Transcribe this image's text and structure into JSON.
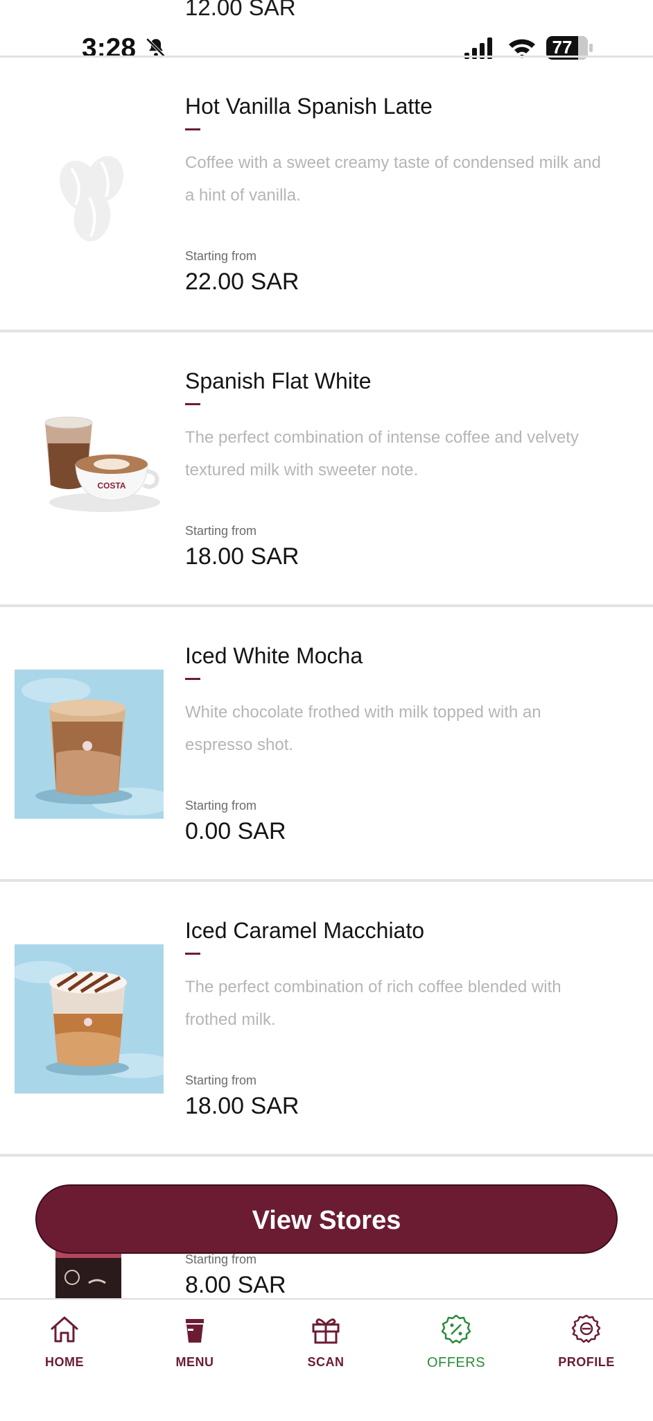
{
  "status_bar": {
    "time": "3:28",
    "battery": "77",
    "cut_off_price": "12.00 SAR"
  },
  "products": [
    {
      "name": "Hot Vanilla Spanish Latte",
      "description": "Coffee with a sweet creamy taste of condensed milk and a hint of vanilla.",
      "price_prefix": "Starting from",
      "price": "22.00 SAR",
      "image": "coffee-bean-placeholder-icon"
    },
    {
      "name": "Spanish Flat White",
      "description": "The perfect combination of intense coffee and velvety textured milk with sweeter note.",
      "price_prefix": "Starting from",
      "price": "18.00 SAR",
      "image": "flat-white-cup-photo",
      "cup_brand": "COSTA"
    },
    {
      "name": "Iced White Mocha",
      "description": "White chocolate frothed with milk topped with an espresso shot.",
      "price_prefix": "Starting from",
      "price": "0.00 SAR",
      "image": "iced-mocha-glass-photo"
    },
    {
      "name": "Iced Caramel Macchiato",
      "description": "The perfect combination of rich coffee blended with frothed milk.",
      "price_prefix": "Starting from",
      "price": "18.00 SAR",
      "image": "iced-caramel-macchiato-photo"
    }
  ],
  "last_item": {
    "price_prefix": "Starting from",
    "price": "8.00 SAR",
    "image": "bottled-drink-photo"
  },
  "view_stores_label": "View Stores",
  "bottom_nav": [
    {
      "label": "HOME",
      "icon": "home-icon",
      "active": false
    },
    {
      "label": "MENU",
      "icon": "cup-icon",
      "active": false
    },
    {
      "label": "SCAN",
      "icon": "gift-icon",
      "active": false
    },
    {
      "label": "OFFERS",
      "icon": "offer-badge-icon",
      "active": true
    },
    {
      "label": "PROFILE",
      "icon": "gear-icon",
      "active": false
    }
  ],
  "colors": {
    "brand": "#6b1c33",
    "active_tab": "#2e8b3a",
    "description_text": "#b5b5b5",
    "divider": "#e3e3e3"
  }
}
